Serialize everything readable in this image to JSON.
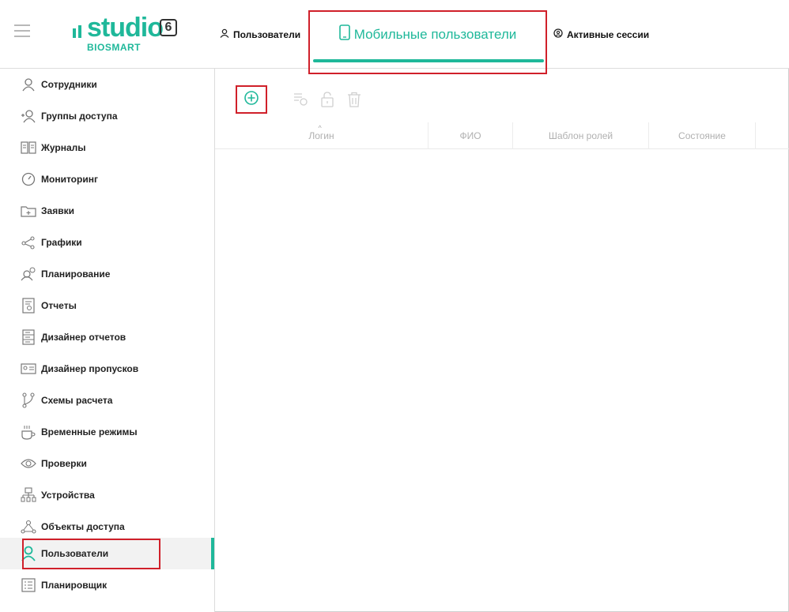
{
  "app": {
    "logo_word": "studio",
    "logo_version": "6",
    "logo_sub": "BIOSMART"
  },
  "header": {
    "tabs": [
      {
        "label": "Пользователи",
        "icon": "user-icon"
      },
      {
        "label": "Мобильные пользователи",
        "icon": "phone-icon",
        "active": true
      },
      {
        "label": "Активные сессии",
        "icon": "session-icon"
      }
    ]
  },
  "sidebar": {
    "items": [
      {
        "label": "Сотрудники",
        "icon": "employee-icon"
      },
      {
        "label": "Группы доступа",
        "icon": "access-group-icon"
      },
      {
        "label": "Журналы",
        "icon": "journal-icon"
      },
      {
        "label": "Мониторинг",
        "icon": "monitoring-icon"
      },
      {
        "label": "Заявки",
        "icon": "requests-icon"
      },
      {
        "label": "Графики",
        "icon": "graphs-icon"
      },
      {
        "label": "Планирование",
        "icon": "planning-icon"
      },
      {
        "label": "Отчеты",
        "icon": "reports-icon"
      },
      {
        "label": "Дизайнер отчетов",
        "icon": "report-designer-icon"
      },
      {
        "label": "Дизайнер пропусков",
        "icon": "pass-designer-icon"
      },
      {
        "label": "Схемы расчета",
        "icon": "calc-schemes-icon"
      },
      {
        "label": "Временные режимы",
        "icon": "time-modes-icon"
      },
      {
        "label": "Проверки",
        "icon": "checks-icon"
      },
      {
        "label": "Устройства",
        "icon": "devices-icon"
      },
      {
        "label": "Объекты доступа",
        "icon": "access-objects-icon"
      },
      {
        "label": "Пользователи",
        "icon": "users-icon",
        "active": true
      },
      {
        "label": "Планировщик",
        "icon": "scheduler-icon"
      }
    ]
  },
  "table": {
    "columns": [
      "Логин",
      "ФИО",
      "Шаблон ролей",
      "Состояние"
    ],
    "sort_indicator": "^"
  },
  "colors": {
    "accent": "#1fb89a",
    "highlight": "#d0202a"
  }
}
